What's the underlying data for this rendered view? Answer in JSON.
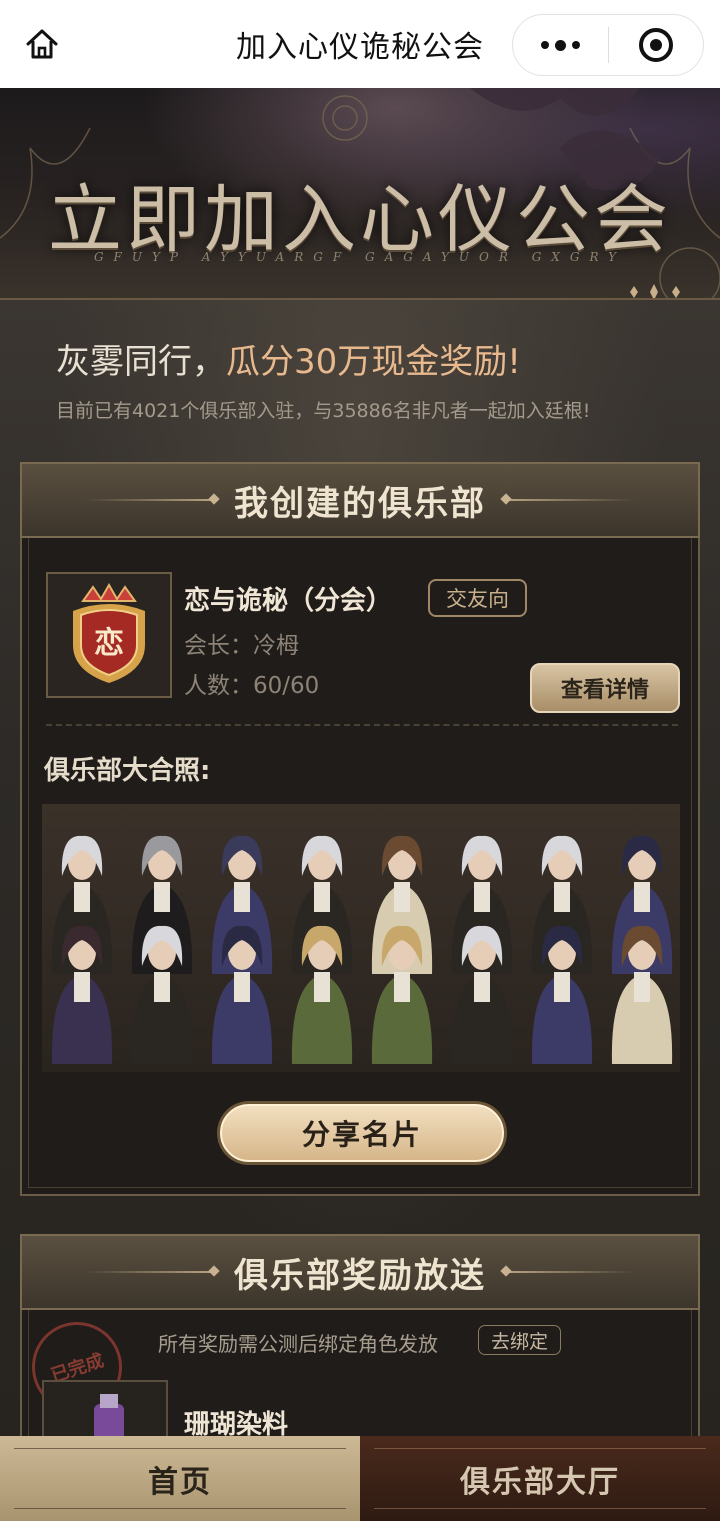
{
  "navbar": {
    "title": "加入心仪诡秘公会",
    "home_icon": "home-icon",
    "more_icon": "more-dots-icon",
    "close_icon": "target-close-icon"
  },
  "banner": {
    "title": "立即加入心仪公会",
    "subtitle": "GFUYP AYYUARGF GAGAYUOR GXGRY"
  },
  "headline": {
    "prefix": "灰雾同行，",
    "accent": "瓜分30万现金奖励!",
    "subline": "目前已有4021个俱乐部入驻，与35886名非凡者一起加入廷根!"
  },
  "club_section": {
    "title": "我创建的俱乐部",
    "emblem_char": "恋",
    "club_name": "恋与诡秘（分会）",
    "tag": "交友向",
    "leader": "会长：冷栂",
    "members": "人数：60/60",
    "detail_button": "查看详情",
    "photo_label": "俱乐部大合照:",
    "share_button": "分享名片"
  },
  "reward_section": {
    "title": "俱乐部奖励放送",
    "note": "所有奖励需公测后绑定角色发放",
    "bind_button": "去绑定",
    "stamp": "已完成",
    "item_name": "珊瑚染料"
  },
  "tabbar": {
    "home": "首页",
    "hall": "俱乐部大厅"
  },
  "colors": {
    "accent": "#e9b98e",
    "gold_button": "#d6b68a",
    "panel_bg": "#1f1c19"
  }
}
